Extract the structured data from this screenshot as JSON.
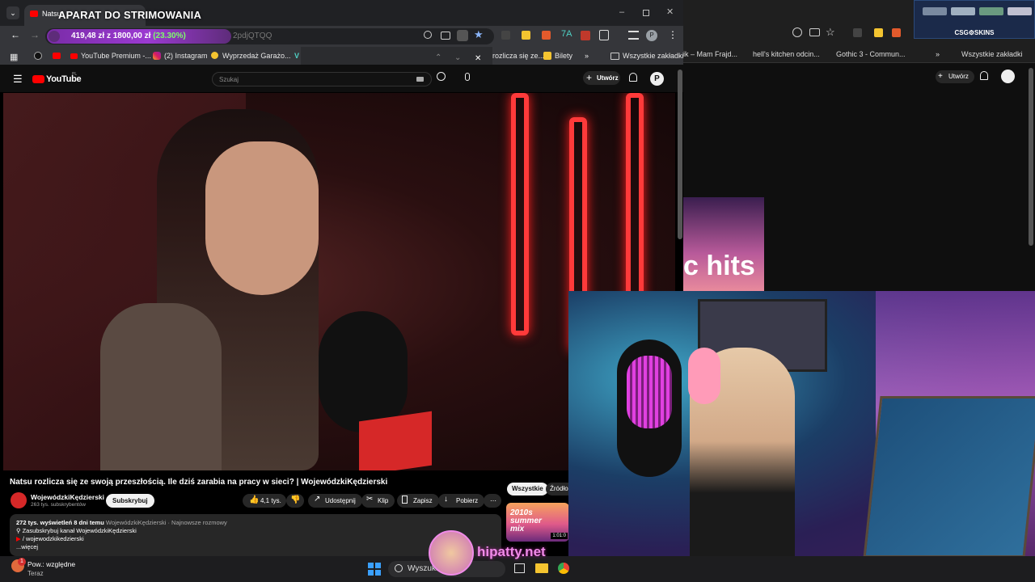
{
  "overlay": {
    "title": "APARAT DO STRIMOWANIA"
  },
  "stream_goal": {
    "current": "419,48 zł",
    "separator": "z",
    "target": "1800,00 zł",
    "percent_text": "(23.30%)",
    "progress": 0.233
  },
  "browser": {
    "tab_title": "Natsu",
    "address_suffix": "2pdjQTQQ",
    "bookmarks": [
      "YouTube Premium -...",
      "(2) Instagram",
      "Wyprzedaż Garażo...",
      "rozlicza się ze...",
      "Bilety",
      "Wszystkie zakładki"
    ]
  },
  "bg_browser": {
    "bookmarks": [
      "ik – Mam Frajd...",
      "hell's kitchen odcin...",
      "Gothic 3 - Commun...",
      "Wszystkie zakładki"
    ],
    "create_label": "Utwórz",
    "sticker_label": "CSG⚙SKINS",
    "thumb_text": "c hits"
  },
  "youtube": {
    "logo": "YouTube",
    "logo_region": "PL",
    "search_placeholder": "Szukaj",
    "create_label": "Utwórz",
    "avatar_letter": "P",
    "video_title": "Natsu rozlicza się ze swoją przeszłością. Ile dziś zarabia na pracy w sieci? | WojewódzkiKędzierski",
    "channel_name": "WojewódzkiKędzierski",
    "subscribers": "263 tys. subskrybentów",
    "subscribe_label": "Subskrybuj",
    "likes": "4,1 tys.",
    "share_label": "Udostępnij",
    "clip_label": "Klip",
    "save_label": "Zapisz",
    "download_label": "Pobierz",
    "filter_all": "Wszystkie",
    "filter_source": "Źródło:",
    "desc_stats": "272 tys. wyświetleń  8 dni temu",
    "desc_tags": "WojewódzkiKędzierski · Najnowsze rozmowy",
    "desc_line1": "Zasubskrybuj kanał WojewódzkiKędzierski",
    "desc_line2": "/ wojewodzkikedzierski",
    "desc_more": "...więcej",
    "rec_thumb_text": "2010s summer mix",
    "rec_duration": "1:01:0"
  },
  "notification": {
    "title": "Pow.: względne",
    "time": "Teraz",
    "badge": "1"
  },
  "taskbar": {
    "search_placeholder": "Wyszukaj"
  },
  "webcam": {
    "watermark": "hipatty.net"
  },
  "colors": {
    "goal_bar": "#8e36c4",
    "goal_percent": "#7dff6a",
    "yt_red": "#ff0000",
    "neon_red": "#ff2a2a",
    "watermark": "#f08be8"
  }
}
